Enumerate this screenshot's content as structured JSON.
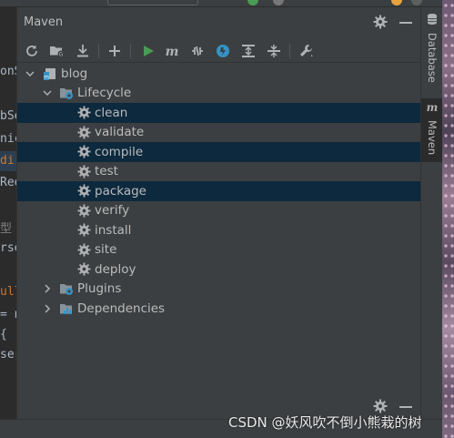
{
  "window": {
    "title": "Maven"
  },
  "colors": {
    "panel_bg": "#3c3f41",
    "selection_bg": "#0d293e",
    "run_green": "#499c54",
    "icon_blue": "#3592c4",
    "text": "#bbbbbb"
  },
  "toolbar": {
    "buttons": [
      {
        "name": "reload-all-projects",
        "icon": "refresh-icon"
      },
      {
        "name": "generate-sources",
        "icon": "folder-generate-icon"
      },
      {
        "name": "download-sources",
        "icon": "download-icon"
      },
      {
        "name": "add-maven-project",
        "icon": "plus-icon"
      },
      {
        "name": "run-maven-build",
        "icon": "run-icon"
      },
      {
        "name": "execute-maven-goal",
        "icon": "maven-m-icon"
      },
      {
        "name": "toggle-offline-mode",
        "icon": "offline-icon"
      },
      {
        "name": "skip-tests",
        "icon": "skip-tests-icon"
      },
      {
        "name": "show-dependencies",
        "icon": "expand-all-icon"
      },
      {
        "name": "collapse-all",
        "icon": "collapse-all-icon"
      },
      {
        "name": "maven-settings",
        "icon": "wrench-icon"
      }
    ]
  },
  "tree": {
    "project": "blog",
    "lifecycle": {
      "label": "Lifecycle",
      "goals": [
        "clean",
        "validate",
        "compile",
        "test",
        "package",
        "verify",
        "install",
        "site",
        "deploy"
      ],
      "selected": [
        "clean",
        "compile",
        "package"
      ]
    },
    "plugins": "Plugins",
    "dependencies": "Dependencies"
  },
  "right_stripe": {
    "tabs": [
      {
        "label": "Database",
        "icon": "database-icon"
      },
      {
        "label": "Maven",
        "icon": "maven-m-icon",
        "active": true
      }
    ]
  },
  "editor_fragments": [
    "onS",
    "bSe",
    "nic",
    "dir",
    "Req",
    "型",
    "rse",
    "ull",
    "= n",
    "{",
    "ser"
  ],
  "watermark": "CSDN @妖风吹不倒小熊栽的树"
}
